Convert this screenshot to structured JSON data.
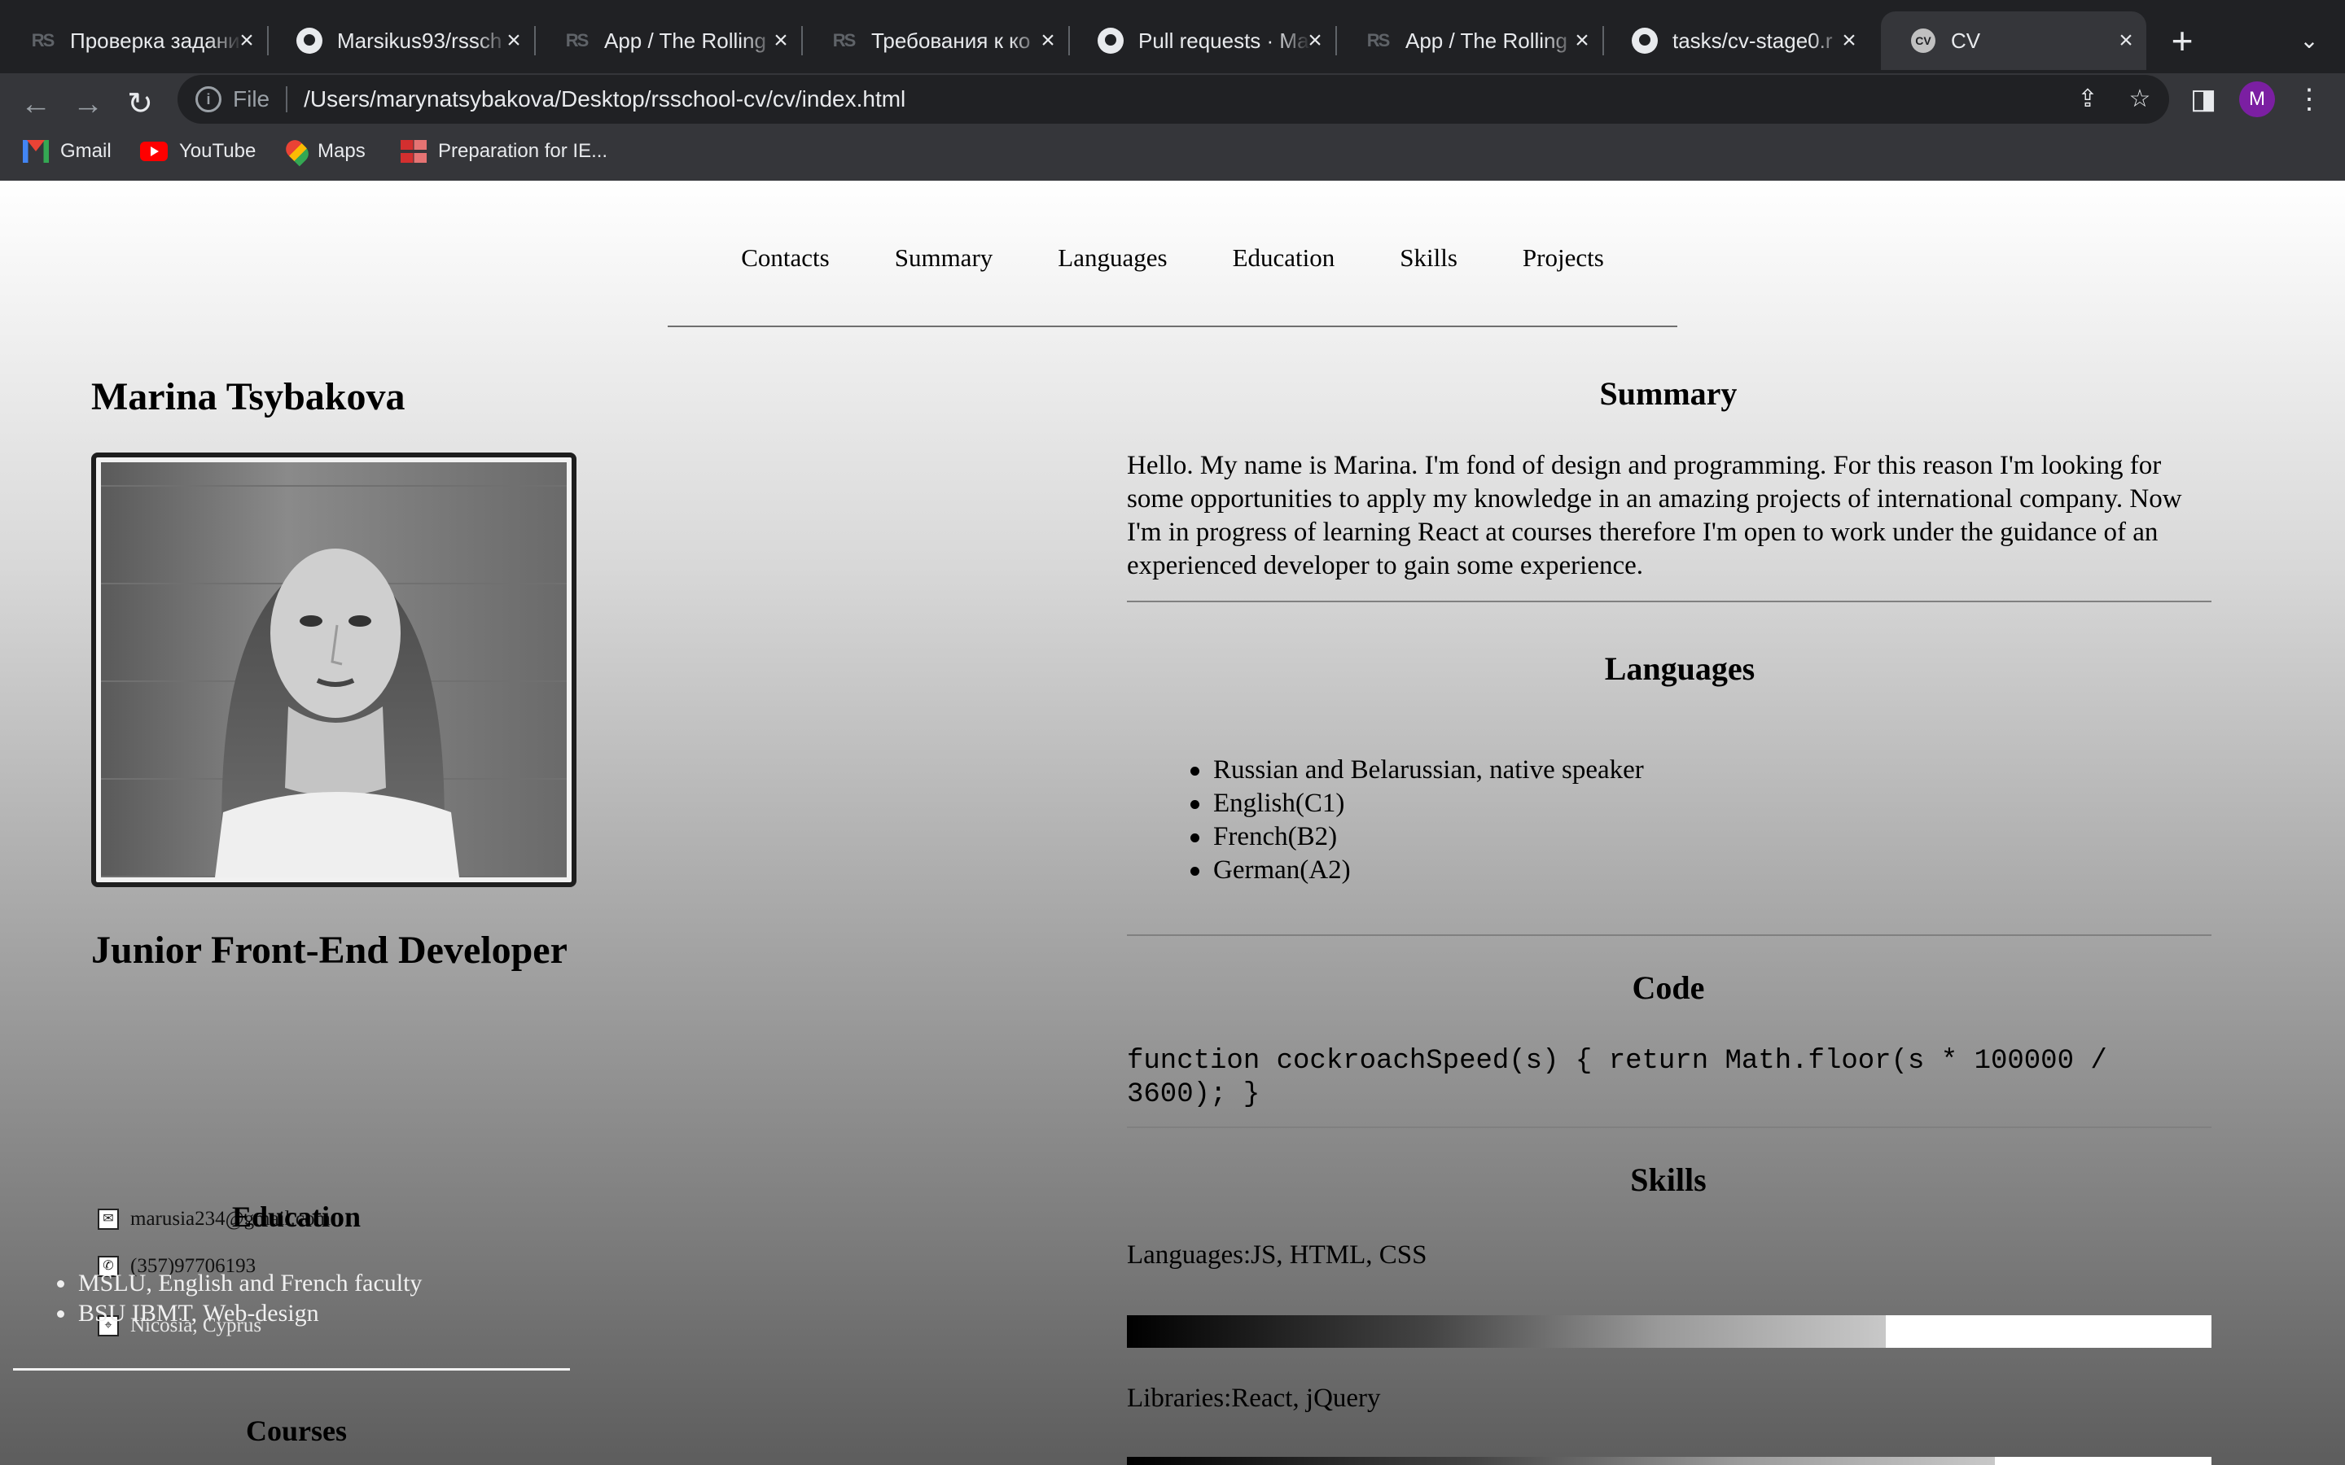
{
  "browser": {
    "tabs": [
      {
        "title": "Проверка задани",
        "icon": "rs-icon"
      },
      {
        "title": "Marsikus93/rssch",
        "icon": "github-icon"
      },
      {
        "title": "App / The Rolling",
        "icon": "rs-icon"
      },
      {
        "title": "Требования к ко",
        "icon": "rs-icon"
      },
      {
        "title": "Pull requests · Ma",
        "icon": "github-icon"
      },
      {
        "title": "App / The Rolling",
        "icon": "rs-icon"
      },
      {
        "title": "tasks/cv-stage0.r",
        "icon": "github-icon"
      },
      {
        "title": "CV",
        "icon": "cv-icon",
        "active": true
      }
    ],
    "address": {
      "scheme": "File",
      "url": "/Users/marynatsybakova/Desktop/rsschool-cv/cv/index.html"
    },
    "profile_initial": "M",
    "bookmarks": [
      {
        "label": "Gmail",
        "icon": "gmail-icon"
      },
      {
        "label": "YouTube",
        "icon": "youtube-icon"
      },
      {
        "label": "Maps",
        "icon": "maps-icon"
      },
      {
        "label": "Preparation for IE...",
        "icon": "grid-icon"
      }
    ]
  },
  "page": {
    "nav": [
      "Contacts",
      "Summary",
      "Languages",
      "Education",
      "Skills",
      "Projects"
    ],
    "name": "Marina Tsybakova",
    "role": "Junior Front-End Developer",
    "contacts": {
      "email": "marusia234@gmail.com",
      "phone": "(357)97706193",
      "location": "Nicosia, Cyprus"
    },
    "education": {
      "heading": "Education",
      "items": [
        "MSLU, English and French faculty",
        "BSU IBMT, Web-design"
      ]
    },
    "courses_heading": "Courses",
    "summary": {
      "heading": "Summary",
      "text": "Hello. My name is Marina. I'm fond of design and programming. For this reason I'm looking for some opportunities to apply my knowledge in an amazing projects of international company. Now I'm in progress of learning React at courses therefore I'm open to work under the guidance of an experienced developer to gain some experience."
    },
    "languages": {
      "heading": "Languages",
      "items": [
        "Russian and Belarussian, native speaker",
        "English(C1)",
        "French(B2)",
        "German(A2)"
      ]
    },
    "code": {
      "heading": "Code",
      "text": "function cockroachSpeed(s) { return Math.floor(s * 100000 / 3600); }"
    },
    "skills": {
      "heading": "Skills",
      "items": [
        {
          "label": "Languages:JS, HTML, CSS",
          "level": 0.7
        },
        {
          "label": "Libraries:React, jQuery",
          "level": 0.8
        }
      ]
    }
  }
}
